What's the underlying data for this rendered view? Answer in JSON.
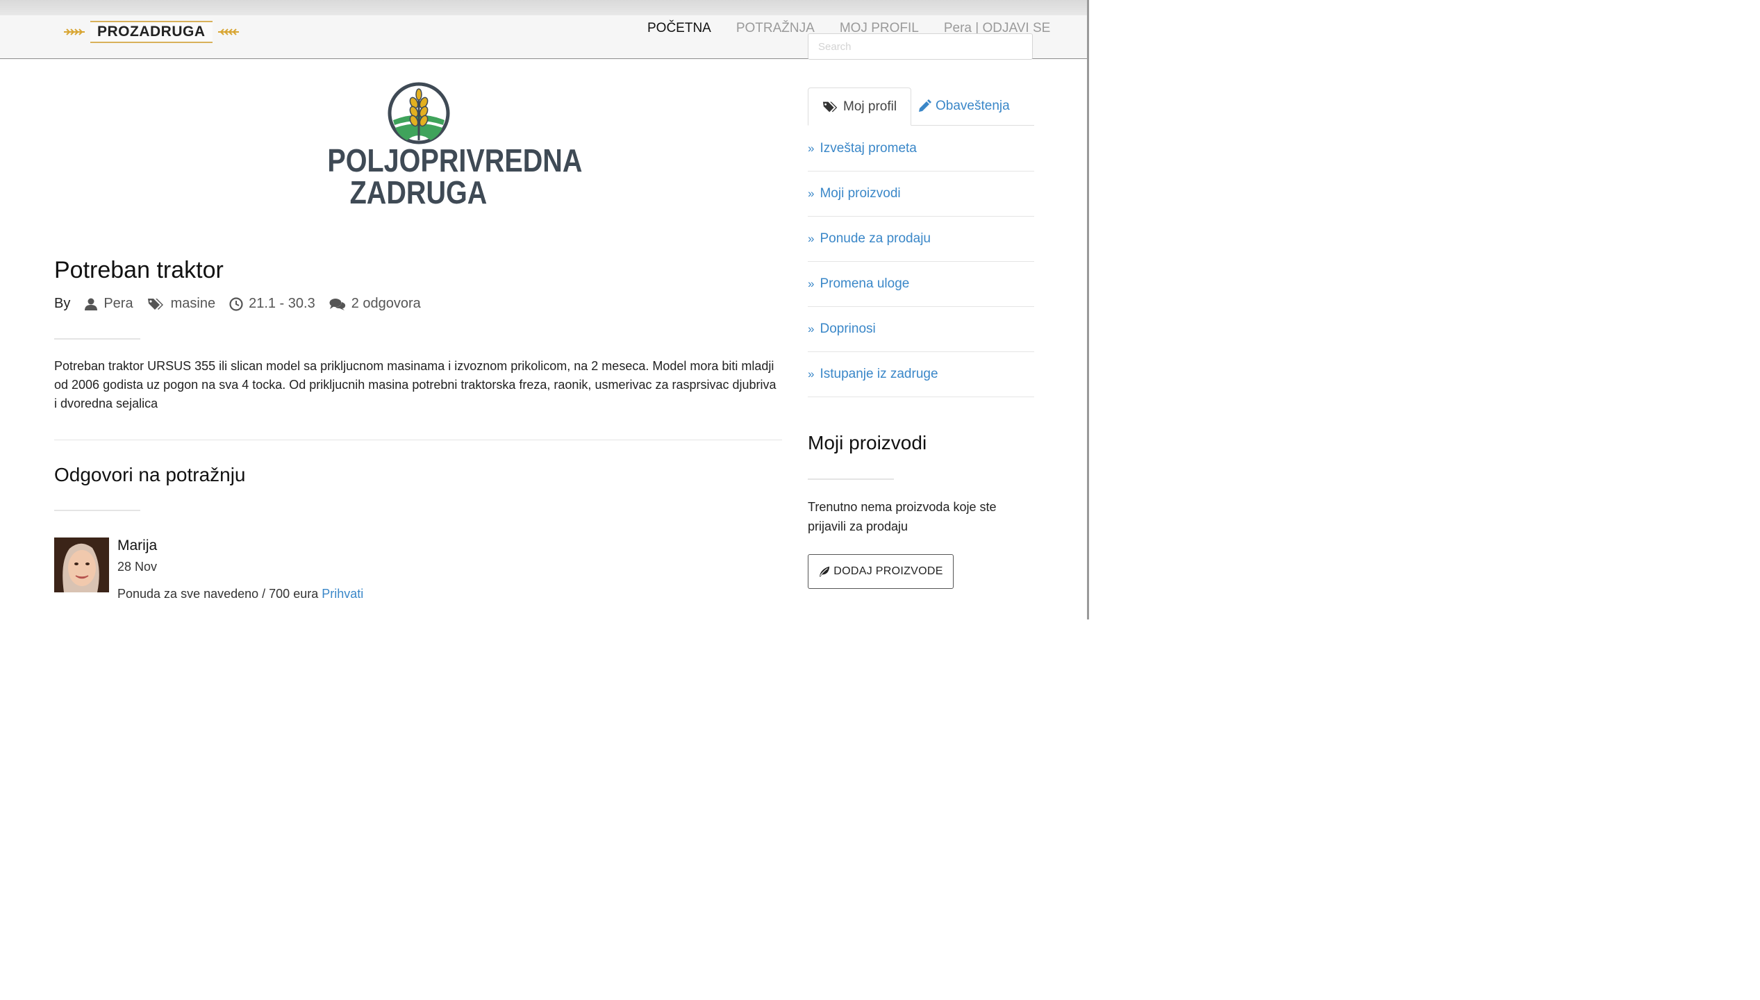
{
  "brand": {
    "name": "PROZADRUGA"
  },
  "nav": {
    "items": [
      {
        "label": "POČETNA"
      },
      {
        "label": "POTRAŽNJA"
      },
      {
        "label": "MOJ PROFIL"
      },
      {
        "label": "Pera | ODJAVI SE"
      }
    ]
  },
  "search": {
    "placeholder": "Search"
  },
  "logo": {
    "line1": "POLJOPRIVREDNA",
    "line2": "ZADRUGA"
  },
  "post": {
    "title": "Potreban traktor",
    "by_label": "By",
    "author": "Pera",
    "category": "masine",
    "date_range": "21.1 - 30.3",
    "replies": "2 odgovora",
    "description": "Potreban traktor URSUS 355 ili slican model sa prikljucnom masinama i izvoznom prikolicom, na 2 meseca. Model mora biti mladji od 2006 godista uz pogon na sva 4 tocka. Od prikljucnih masina potrebni traktorska freza, raonik, usmerivac za rasprsivac djubriva i dvoredna sejalica"
  },
  "answers": {
    "title": "Odgovori na potražnju",
    "items": [
      {
        "name": "Marija",
        "date": "28 Nov",
        "text": "Ponuda za sve navedeno / 700 eura",
        "action": "Prihvati"
      }
    ]
  },
  "sidebar": {
    "tabs": [
      {
        "label": "Moj profil",
        "icon": "tags-icon"
      },
      {
        "label": "Obaveštenja",
        "icon": "pencil-icon"
      }
    ],
    "menu": [
      {
        "label": "Izveštaj prometa"
      },
      {
        "label": "Moji proizvodi"
      },
      {
        "label": "Ponude za prodaju"
      },
      {
        "label": "Promena uloge"
      },
      {
        "label": "Doprinosi"
      },
      {
        "label": "Istupanje iz zadruge"
      }
    ],
    "products": {
      "title": "Moji proizvodi",
      "empty_text": "Trenutno nema proizvoda koje ste prijavili za prodaju",
      "button_label": "DODAJ PROIZVODE"
    }
  },
  "colors": {
    "link": "#3a87c8",
    "logo_text": "#3f4a55",
    "logo_green": "#3fa35b",
    "logo_gold": "#e3b020"
  }
}
